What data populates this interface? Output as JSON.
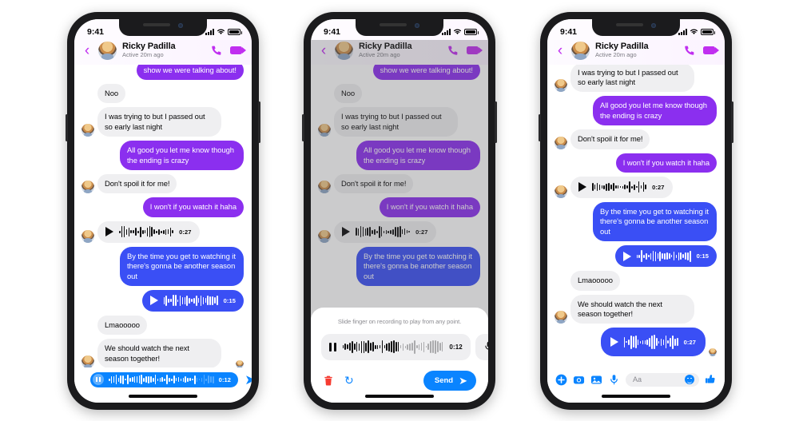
{
  "meta": {
    "status_time": "9:41",
    "brand_purple": "#8b2fef",
    "brand_blue": "#3a4ff5",
    "accent_blue": "#0a84ff",
    "bubble_gray": "#efeff1",
    "delete_red": "#f63b30"
  },
  "header": {
    "name": "Ricky Padilla",
    "status": "Active 20m ago",
    "back_icon": "‹",
    "call_icon": "✆",
    "video_icon": "video-camera"
  },
  "messages": {
    "m0": "show we were talking about!",
    "m1": "Noo",
    "m2": "I was trying to but I passed out so early last night",
    "m3": "All good you let me know though the ending is crazy",
    "m4": "Don't spoil it for me!",
    "m5": "I won't if you watch it haha",
    "m6_duration": "0:27",
    "m7": "By the time you get to watching it there's gonna be another season out",
    "m8_duration": "0:15",
    "m9": "Lmaooooo",
    "m10": "We should watch the next season together!",
    "m11_duration": "0:27"
  },
  "phone1": {
    "recording": {
      "duration": "0:12",
      "trash_icon": "trash-icon",
      "pause_icon": "pause-icon",
      "send_icon": "➤"
    }
  },
  "phone2": {
    "sheet": {
      "hint": "Slide finger on recording to play from any point.",
      "duration": "0:12",
      "mic_icon": "mic-add-icon",
      "trash_icon": "trash-icon",
      "redo_icon": "↻",
      "send_label": "Send",
      "send_arrow": "➤"
    }
  },
  "phone3": {
    "composer": {
      "plus_label": "+",
      "camera_label": "camera-icon",
      "gallery_label": "gallery-icon",
      "mic_label": "mic-icon",
      "input_placeholder": "Aa",
      "emoji_label": "emoji-icon",
      "thumb_label": "👍"
    }
  },
  "chart_data": null
}
